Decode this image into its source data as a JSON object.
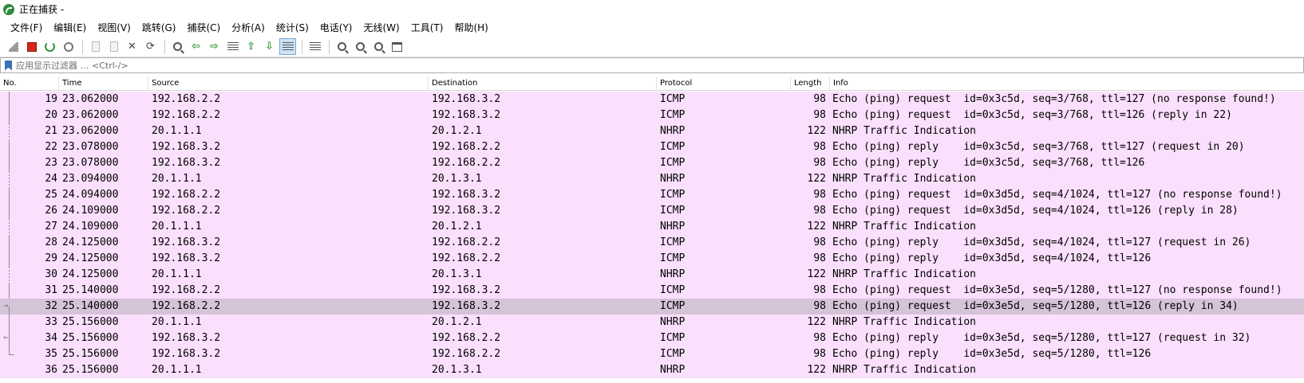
{
  "window": {
    "title": "正在捕获 -"
  },
  "menubar": [
    "文件(F)",
    "编辑(E)",
    "视图(V)",
    "跳转(G)",
    "捕获(C)",
    "分析(A)",
    "统计(S)",
    "电话(Y)",
    "无线(W)",
    "工具(T)",
    "帮助(H)"
  ],
  "toolbar": {
    "icons": [
      "shark-fin-start-icon",
      "stop-capture-icon",
      "restart-capture-icon",
      "capture-options-icon",
      "open-file-icon",
      "save-file-icon",
      "close-file-icon",
      "reload-file-icon",
      "find-packet-icon",
      "go-back-icon",
      "go-forward-icon",
      "go-to-packet-icon",
      "first-packet-icon",
      "last-packet-icon",
      "auto-scroll-icon",
      "colorize-icon",
      "zoom-in-icon",
      "zoom-out-icon",
      "zoom-reset-icon",
      "resize-columns-icon"
    ],
    "active": [
      "auto-scroll-icon"
    ]
  },
  "filter": {
    "placeholder": "应用显示过滤器 … <Ctrl-/>",
    "value": ""
  },
  "columns": {
    "no": "No.",
    "time": "Time",
    "source": "Source",
    "destination": "Destination",
    "protocol": "Protocol",
    "length": "Length",
    "info": "Info"
  },
  "packets": [
    {
      "no": "19",
      "time": "23.062000",
      "source": "192.168.2.2",
      "destination": "192.168.3.2",
      "protocol": "ICMP",
      "length": "98",
      "info": "Echo (ping) request  id=0x3c5d, seq=3/768, ttl=127 (no response found!)"
    },
    {
      "no": "20",
      "time": "23.062000",
      "source": "192.168.2.2",
      "destination": "192.168.3.2",
      "protocol": "ICMP",
      "length": "98",
      "info": "Echo (ping) request  id=0x3c5d, seq=3/768, ttl=126 (reply in 22)"
    },
    {
      "no": "21",
      "time": "23.062000",
      "source": "20.1.1.1",
      "destination": "20.1.2.1",
      "protocol": "NHRP",
      "length": "122",
      "info": "NHRP Traffic Indication"
    },
    {
      "no": "22",
      "time": "23.078000",
      "source": "192.168.3.2",
      "destination": "192.168.2.2",
      "protocol": "ICMP",
      "length": "98",
      "info": "Echo (ping) reply    id=0x3c5d, seq=3/768, ttl=127 (request in 20)"
    },
    {
      "no": "23",
      "time": "23.078000",
      "source": "192.168.3.2",
      "destination": "192.168.2.2",
      "protocol": "ICMP",
      "length": "98",
      "info": "Echo (ping) reply    id=0x3c5d, seq=3/768, ttl=126"
    },
    {
      "no": "24",
      "time": "23.094000",
      "source": "20.1.1.1",
      "destination": "20.1.3.1",
      "protocol": "NHRP",
      "length": "122",
      "info": "NHRP Traffic Indication"
    },
    {
      "no": "25",
      "time": "24.094000",
      "source": "192.168.2.2",
      "destination": "192.168.3.2",
      "protocol": "ICMP",
      "length": "98",
      "info": "Echo (ping) request  id=0x3d5d, seq=4/1024, ttl=127 (no response found!)"
    },
    {
      "no": "26",
      "time": "24.109000",
      "source": "192.168.2.2",
      "destination": "192.168.3.2",
      "protocol": "ICMP",
      "length": "98",
      "info": "Echo (ping) request  id=0x3d5d, seq=4/1024, ttl=126 (reply in 28)"
    },
    {
      "no": "27",
      "time": "24.109000",
      "source": "20.1.1.1",
      "destination": "20.1.2.1",
      "protocol": "NHRP",
      "length": "122",
      "info": "NHRP Traffic Indication"
    },
    {
      "no": "28",
      "time": "24.125000",
      "source": "192.168.3.2",
      "destination": "192.168.2.2",
      "protocol": "ICMP",
      "length": "98",
      "info": "Echo (ping) reply    id=0x3d5d, seq=4/1024, ttl=127 (request in 26)"
    },
    {
      "no": "29",
      "time": "24.125000",
      "source": "192.168.3.2",
      "destination": "192.168.2.2",
      "protocol": "ICMP",
      "length": "98",
      "info": "Echo (ping) reply    id=0x3d5d, seq=4/1024, ttl=126"
    },
    {
      "no": "30",
      "time": "24.125000",
      "source": "20.1.1.1",
      "destination": "20.1.3.1",
      "protocol": "NHRP",
      "length": "122",
      "info": "NHRP Traffic Indication"
    },
    {
      "no": "31",
      "time": "25.140000",
      "source": "192.168.2.2",
      "destination": "192.168.3.2",
      "protocol": "ICMP",
      "length": "98",
      "info": "Echo (ping) request  id=0x3e5d, seq=5/1280, ttl=127 (no response found!)"
    },
    {
      "no": "32",
      "time": "25.140000",
      "source": "192.168.2.2",
      "destination": "192.168.3.2",
      "protocol": "ICMP",
      "length": "98",
      "info": "Echo (ping) request  id=0x3e5d, seq=5/1280, ttl=126 (reply in 34)",
      "selected": true
    },
    {
      "no": "33",
      "time": "25.156000",
      "source": "20.1.1.1",
      "destination": "20.1.2.1",
      "protocol": "NHRP",
      "length": "122",
      "info": "NHRP Traffic Indication"
    },
    {
      "no": "34",
      "time": "25.156000",
      "source": "192.168.3.2",
      "destination": "192.168.2.2",
      "protocol": "ICMP",
      "length": "98",
      "info": "Echo (ping) reply    id=0x3e5d, seq=5/1280, ttl=127 (request in 32)"
    },
    {
      "no": "35",
      "time": "25.156000",
      "source": "192.168.3.2",
      "destination": "192.168.2.2",
      "protocol": "ICMP",
      "length": "98",
      "info": "Echo (ping) reply    id=0x3e5d, seq=5/1280, ttl=126"
    },
    {
      "no": "36",
      "time": "25.156000",
      "source": "20.1.1.1",
      "destination": "20.1.3.1",
      "protocol": "NHRP",
      "length": "122",
      "info": "NHRP Traffic Indication"
    }
  ]
}
